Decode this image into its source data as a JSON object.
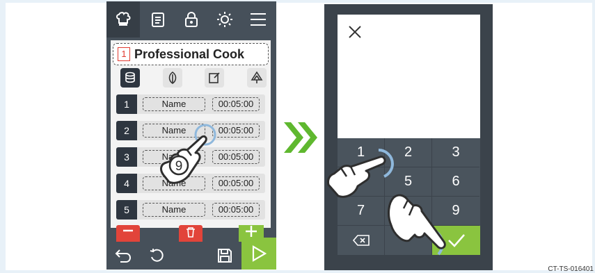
{
  "left_screen": {
    "topbar_icons": [
      "chef-hat-icon",
      "clipboard-icon",
      "lock-icon",
      "brightness-icon",
      "menu-icon"
    ],
    "program": {
      "number": "1",
      "title": "Professional Cook"
    },
    "mode_icons": [
      "stack-icon",
      "leaf-icon",
      "edit-icon",
      "tree-icon"
    ],
    "steps": [
      {
        "num": "1",
        "name": "Name",
        "time": "00:05:00"
      },
      {
        "num": "2",
        "name": "Name",
        "time": "00:05:00"
      },
      {
        "num": "3",
        "name": "Name",
        "time": "00:05:00"
      },
      {
        "num": "4",
        "name": "Name",
        "time": "00:05:00"
      },
      {
        "num": "5",
        "name": "Name",
        "time": "00:05:00"
      }
    ],
    "tap_number": "9",
    "bottom_icons": [
      "back-icon",
      "undo-icon",
      "save-icon",
      "play-icon"
    ]
  },
  "right_screen": {
    "keys": [
      "1",
      "2",
      "3",
      "5",
      "6",
      "7",
      "9"
    ],
    "backspace": "backspace-icon",
    "confirm": "check-icon"
  },
  "figure_code": "CT-TS-016401",
  "colors": {
    "dark": "#46505a",
    "green": "#8ac43f",
    "red": "#e2443a"
  }
}
